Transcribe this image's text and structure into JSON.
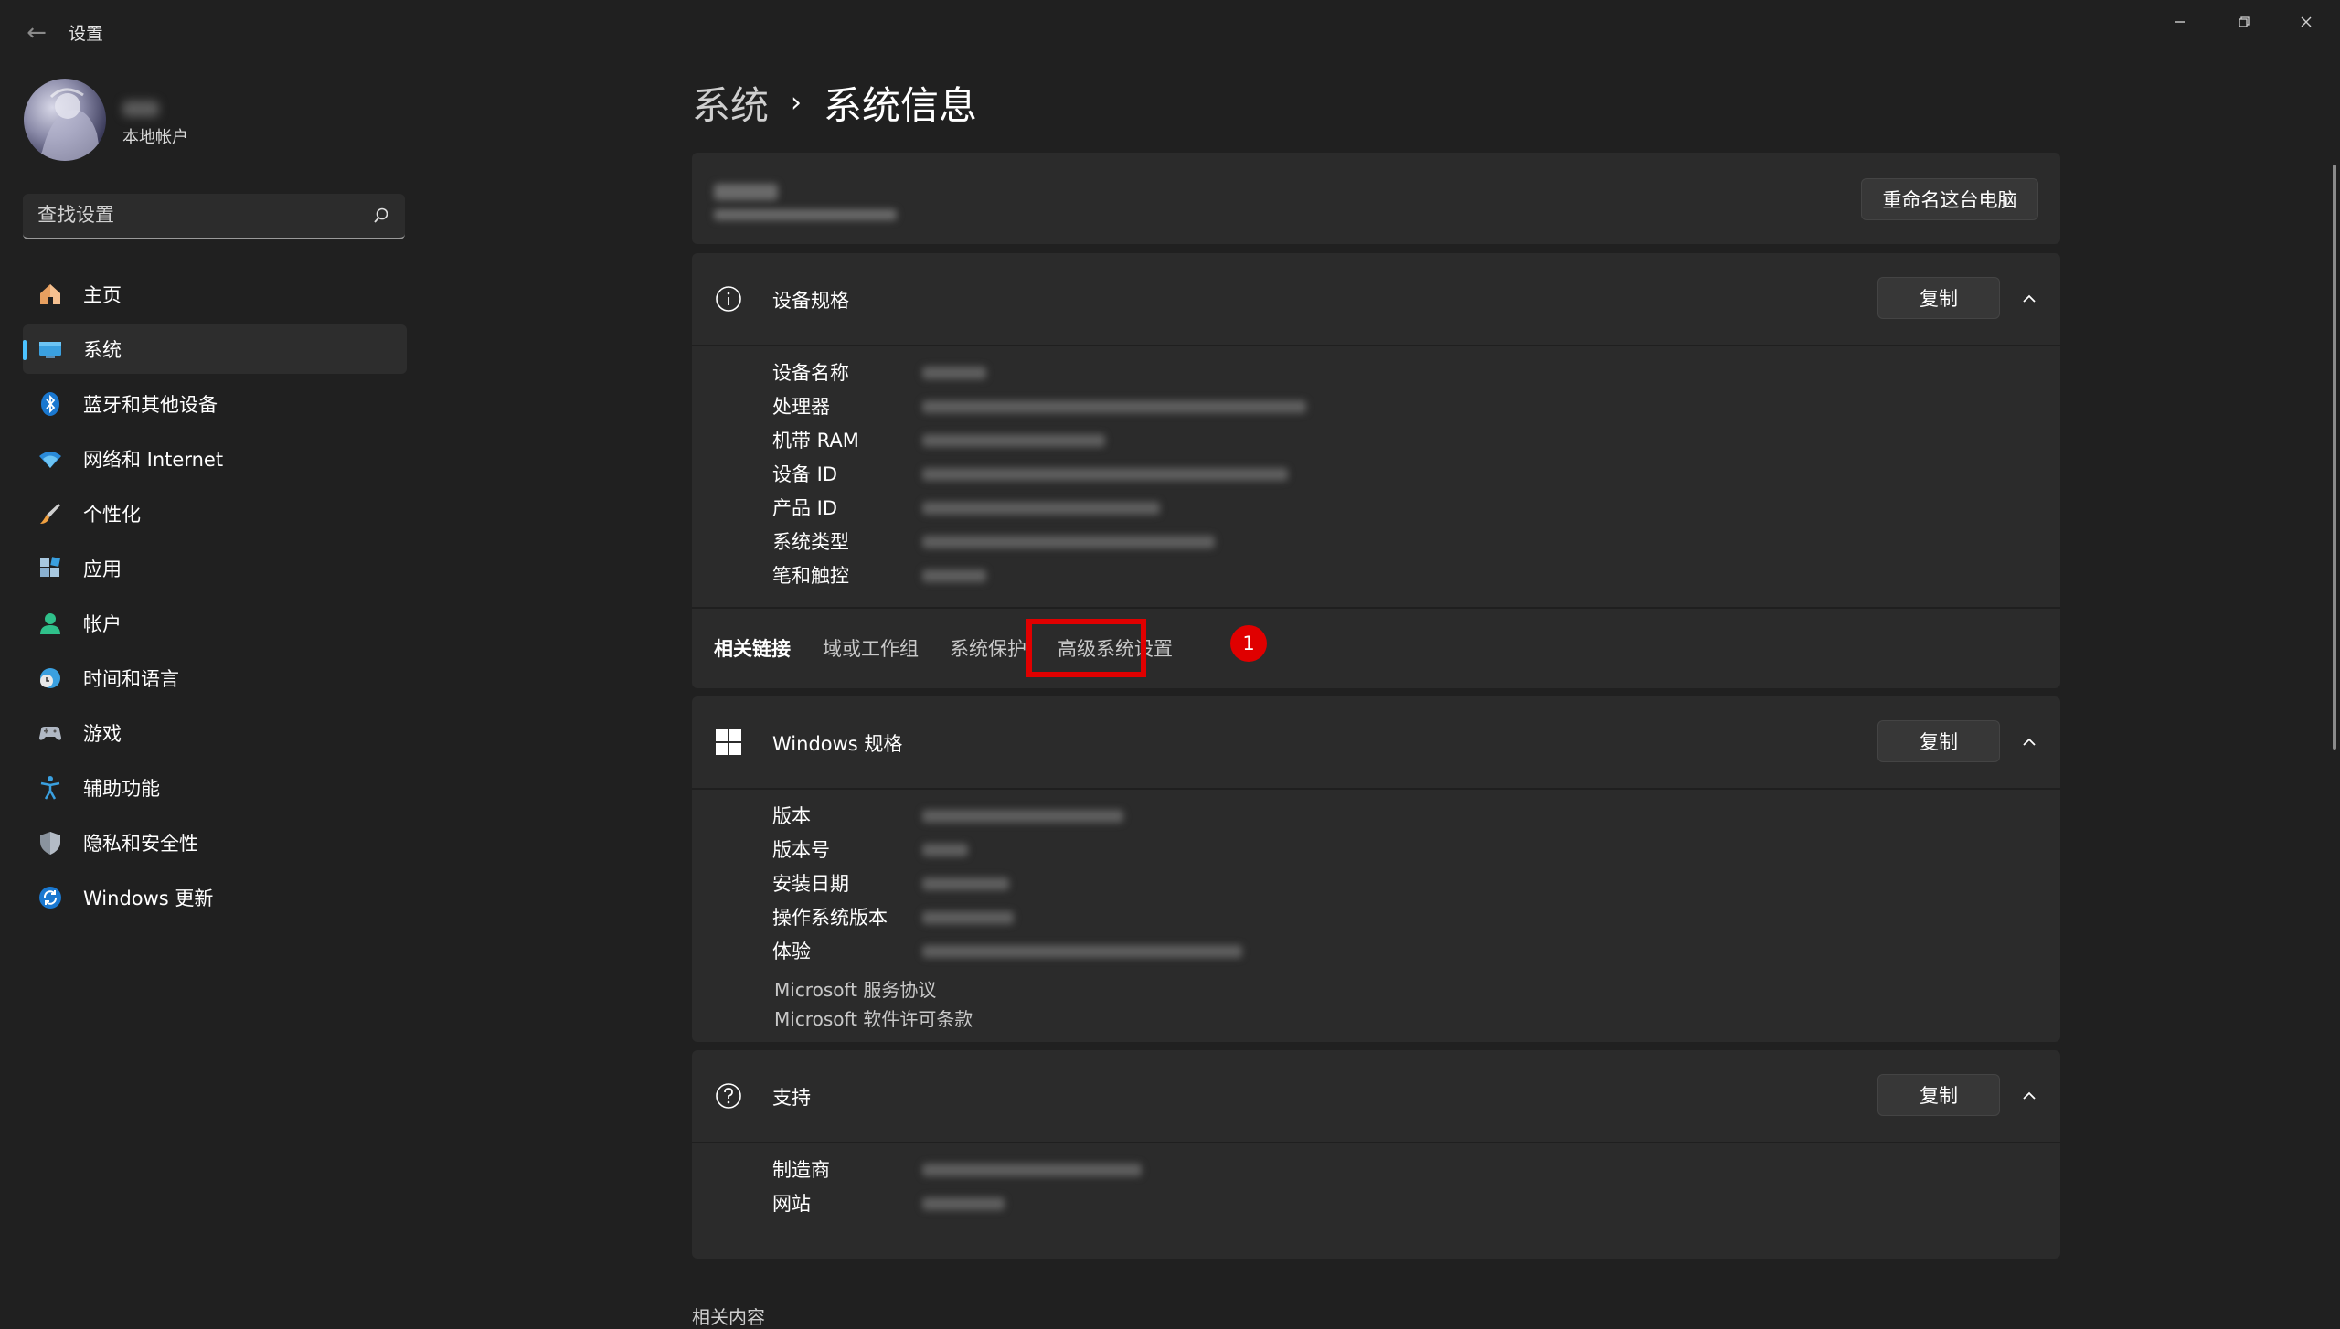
{
  "window": {
    "title": "设置",
    "back_icon": "back-arrow-icon",
    "controls": [
      "minimize-icon",
      "restore-icon",
      "close-icon"
    ]
  },
  "profile": {
    "account_type": "本地帐户"
  },
  "search": {
    "placeholder": "查找设置"
  },
  "sidebar": {
    "items": [
      {
        "label": "主页",
        "icon": "home-icon"
      },
      {
        "label": "系统",
        "icon": "system-icon",
        "active": true
      },
      {
        "label": "蓝牙和其他设备",
        "icon": "bluetooth-icon"
      },
      {
        "label": "网络和 Internet",
        "icon": "wifi-icon"
      },
      {
        "label": "个性化",
        "icon": "brush-icon"
      },
      {
        "label": "应用",
        "icon": "apps-icon"
      },
      {
        "label": "帐户",
        "icon": "account-icon"
      },
      {
        "label": "时间和语言",
        "icon": "globe-clock-icon"
      },
      {
        "label": "游戏",
        "icon": "gamepad-icon"
      },
      {
        "label": "辅助功能",
        "icon": "accessibility-icon"
      },
      {
        "label": "隐私和安全性",
        "icon": "shield-icon"
      },
      {
        "label": "Windows 更新",
        "icon": "update-icon"
      }
    ]
  },
  "breadcrumb": {
    "parent": "系统",
    "separator": "›",
    "current": "系统信息"
  },
  "pc_card": {
    "rename_label": "重命名这台电脑"
  },
  "device_specs": {
    "title": "设备规格",
    "copy_label": "复制",
    "rows": [
      "设备名称",
      "处理器",
      "机带 RAM",
      "设备 ID",
      "产品 ID",
      "系统类型",
      "笔和触控"
    ]
  },
  "related_links": {
    "label": "相关链接",
    "links": [
      "域或工作组",
      "系统保护",
      "高级系统设置"
    ],
    "badge": "1"
  },
  "windows_specs": {
    "title": "Windows 规格",
    "copy_label": "复制",
    "rows": [
      "版本",
      "版本号",
      "安装日期",
      "操作系统版本",
      "体验"
    ],
    "links": [
      "Microsoft 服务协议",
      "Microsoft 软件许可条款"
    ]
  },
  "support": {
    "title": "支持",
    "copy_label": "复制",
    "rows": [
      "制造商",
      "网站"
    ]
  },
  "related_section_title": "相关内容",
  "colors": {
    "background": "#202020",
    "card": "#2b2b2b",
    "accent": "#4cc2ff",
    "highlight": "#e00000"
  }
}
